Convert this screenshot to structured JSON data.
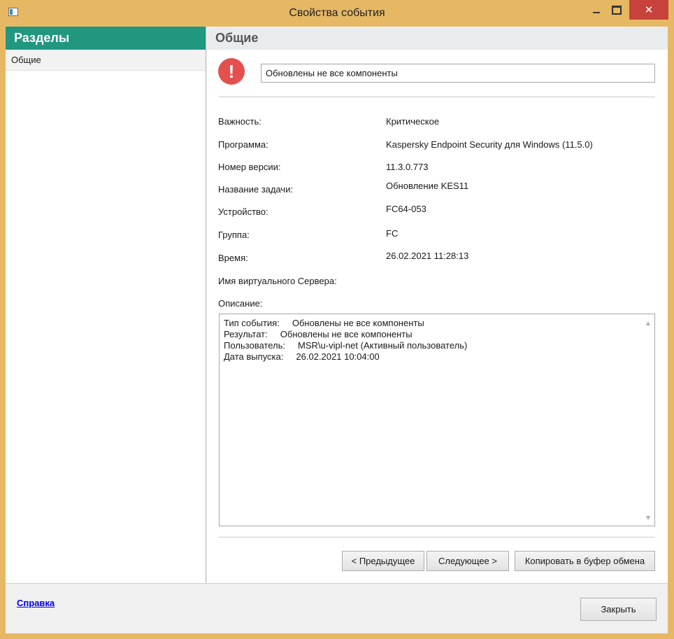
{
  "window": {
    "title": "Свойства события",
    "close_glyph": "✕"
  },
  "left": {
    "header": "Разделы",
    "items": [
      {
        "label": "Общие"
      }
    ]
  },
  "right": {
    "header": "Общие",
    "alert_glyph": "!",
    "event_name": "Обновлены не все компоненты",
    "fields": [
      {
        "label": "Важность:",
        "value": "Критическое"
      },
      {
        "label": "Программа:",
        "value": "Kaspersky Endpoint Security для Windows (11.5.0)"
      },
      {
        "label": "Номер версии:",
        "value": "11.3.0.773"
      },
      {
        "label": "Название задачи:",
        "value": "Обновление KES11"
      },
      {
        "label": "Устройство:",
        "value": "FC64-053"
      },
      {
        "label": "Группа:",
        "value": "FC"
      },
      {
        "label": "Время:",
        "value": "26.02.2021 11:28:13"
      },
      {
        "label": "Имя виртуального Сервера:",
        "value": ""
      }
    ],
    "description_label": "Описание:",
    "description_lines": [
      "Тип события:     Обновлены не все компоненты",
      "Результат:     Обновлены не все компоненты",
      "Пользователь:     MSR\\u-vipl-net (Активный пользователь)",
      "Дата выпуска:     26.02.2021 10:04:00"
    ],
    "buttons": {
      "prev": "< Предыдущее",
      "next": "Следующее >",
      "copy": "Копировать в буфер обмена"
    }
  },
  "footer": {
    "help_link": "Справка",
    "close_button": "Закрыть"
  }
}
